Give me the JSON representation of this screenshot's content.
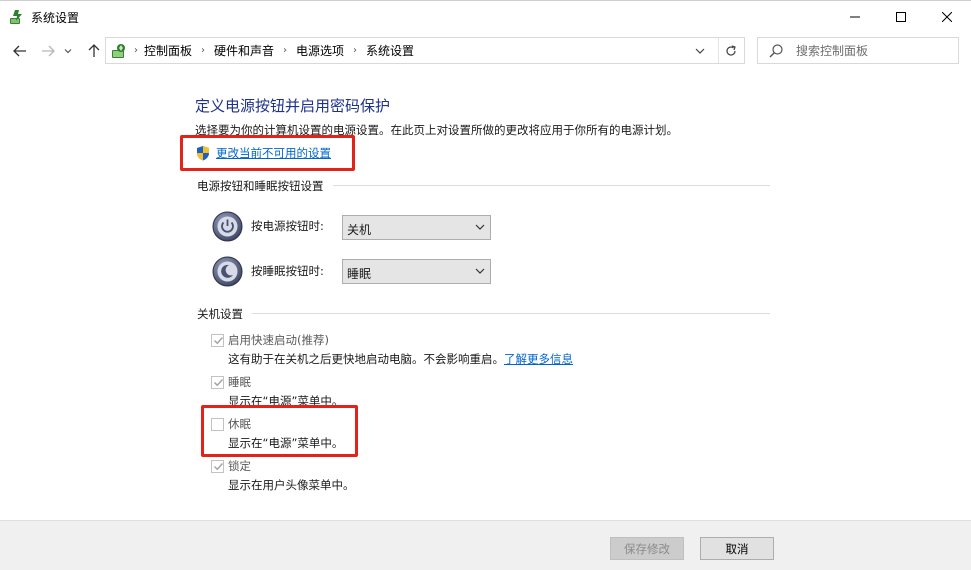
{
  "window": {
    "title": "系统设置",
    "minimize_glyph": "—",
    "maximize_glyph": "☐",
    "close_glyph": "✕"
  },
  "nav": {
    "breadcrumbs": [
      "控制面板",
      "硬件和声音",
      "电源选项",
      "系统设置"
    ],
    "search_placeholder": "搜索控制面板"
  },
  "main": {
    "heading": "定义电源按钮并启用密码保护",
    "description": "选择要为你的计算机设置的电源设置。在此页上对设置所做的更改将应用于你所有的电源计划。",
    "change_link": "更改当前不可用的设置",
    "power_section": {
      "title": "电源按钮和睡眠按钮设置",
      "power_button_label": "按电源按钮时:",
      "power_button_value": "关机",
      "sleep_button_label": "按睡眠按钮时:",
      "sleep_button_value": "睡眠"
    },
    "shutdown_section": {
      "title": "关机设置",
      "items": [
        {
          "label": "启用快速启动(推荐)",
          "desc": "这有助于在关机之后更快地启动电脑。不会影响重启。",
          "link": "了解更多信息",
          "checked": true
        },
        {
          "label": "睡眠",
          "desc": "显示在“电源”菜单中。",
          "checked": true
        },
        {
          "label": "休眠",
          "desc": "显示在“电源”菜单中。",
          "checked": false
        },
        {
          "label": "锁定",
          "desc": "显示在用户头像菜单中。",
          "checked": true
        }
      ]
    }
  },
  "footer": {
    "save_label": "保存修改",
    "cancel_label": "取消"
  },
  "colors": {
    "heading": "#1e3287",
    "link": "#0066cc",
    "highlight_box": "#e2231a"
  }
}
